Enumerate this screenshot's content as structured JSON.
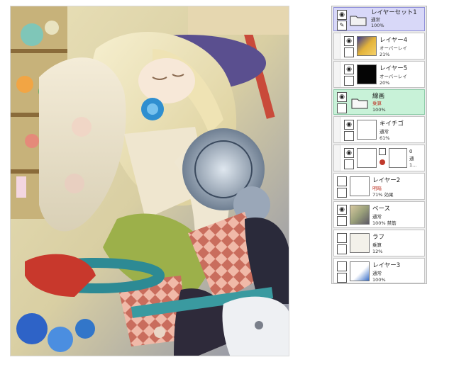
{
  "layers": [
    {
      "name": "レイヤーセット1",
      "mode": "通常",
      "opacity": "100%",
      "kind": "folder",
      "state": "selected"
    },
    {
      "name": "レイヤー4",
      "mode": "オーバーレイ",
      "opacity": "21%",
      "kind": "layer",
      "thumb": "gold"
    },
    {
      "name": "レイヤー5",
      "mode": "オーバーレイ",
      "opacity": "20%",
      "kind": "layer",
      "thumb": "black"
    },
    {
      "name": "線画",
      "mode": "乗算",
      "opacity": "100%",
      "kind": "folder",
      "state": "green"
    },
    {
      "name": "キイチゴ",
      "mode": "通常",
      "opacity": "61%",
      "kind": "layer",
      "thumb": "white"
    },
    {
      "name": "0",
      "mode": "通",
      "opacity": "1...",
      "kind": "mask",
      "thumb": "white"
    },
    {
      "name": "レイヤー2",
      "mode": "明暗",
      "opacity": "71% 効果",
      "kind": "layer",
      "thumb": "white"
    },
    {
      "name": "ベース",
      "mode": "通常",
      "opacity": "100% 禁筋",
      "kind": "layer",
      "thumb": "art"
    },
    {
      "name": "ラフ",
      "mode": "乗算",
      "opacity": "12%",
      "kind": "layer",
      "thumb": "sketch"
    },
    {
      "name": "レイヤー3",
      "mode": "通常",
      "opacity": "100%",
      "kind": "layer",
      "thumb": "blue"
    }
  ],
  "colors": {
    "selected_folder": "#d8d8f8",
    "green_folder": "#c8f2d8",
    "mode_red": "#c0392b"
  },
  "icons": {
    "visibility": "eye-icon",
    "folder": "folder-icon",
    "link": "brush-icon"
  }
}
